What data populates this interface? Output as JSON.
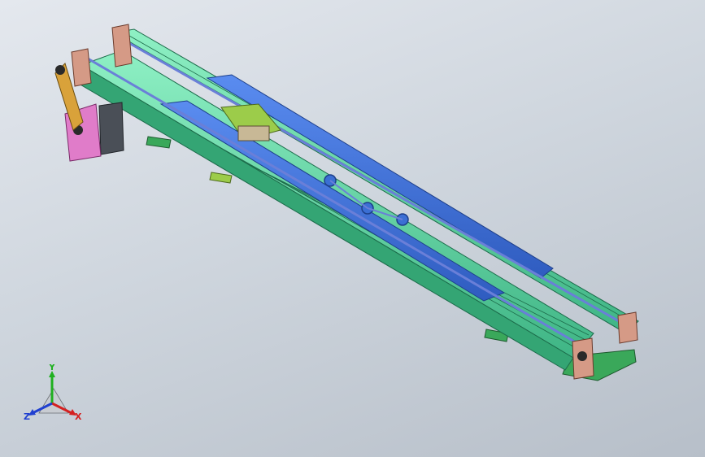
{
  "viewport": {
    "background_top": "#e4e8ee",
    "background_bottom": "#b7bfc9"
  },
  "model": {
    "colors": {
      "extrusion": "#5ad0a0",
      "extrusion_edge": "#1c6b4a",
      "guide_rail": "#3b6fd4",
      "belt": "#6a7fd8",
      "end_plate": "#d59a86",
      "motor_plate": "#e07cc9",
      "motor_body": "#4a4f57",
      "carriage": "#9ccc4a",
      "base_plate": "#3aa85a",
      "drive_arm": "#d9a23a"
    }
  },
  "triad": {
    "x_label": "X",
    "y_label": "Y",
    "z_label": "Z",
    "x_color": "#d42020",
    "y_color": "#20b020",
    "z_color": "#2040d0"
  }
}
